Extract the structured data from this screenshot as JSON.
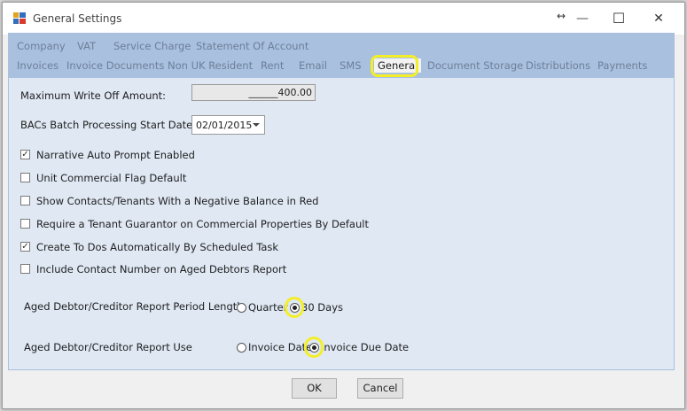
{
  "window": {
    "title": "General Settings",
    "icons": {
      "app": "app-icon",
      "resize": "resize-arrows-icon",
      "minimize": "minimize-icon",
      "maximize": "maximize-icon",
      "close": "close-icon"
    },
    "glyphs": {
      "resize": "↔",
      "minimize": "—",
      "maximize": "☐",
      "close": "✕"
    }
  },
  "tabs": {
    "row1": [
      "Company",
      "VAT",
      "Service Charge",
      "Statement Of Account"
    ],
    "row2": [
      "Invoices",
      "Invoice Documents",
      "Non UK Resident",
      "Rent",
      "Email",
      "SMS",
      "General",
      "Document Storage",
      "Distributions",
      "Payments"
    ],
    "active": "General"
  },
  "form": {
    "max_write_off_label": "Maximum Write Off Amount:",
    "max_write_off_value": "______400.00",
    "bacs_label": "BACs Batch Processing Start Date:",
    "bacs_value": "02/01/2015",
    "checkboxes": [
      {
        "label": "Narrative Auto Prompt Enabled",
        "checked": true
      },
      {
        "label": "Unit Commercial Flag Default",
        "checked": false
      },
      {
        "label": "Show Contacts/Tenants With a Negative Balance in Red",
        "checked": false
      },
      {
        "label": "Require a Tenant Guarantor on Commercial Properties By Default",
        "checked": false
      },
      {
        "label": "Create To Dos Automatically By Scheduled Task",
        "checked": true
      },
      {
        "label": "Include Contact Number on Aged Debtors Report",
        "checked": false
      }
    ],
    "period_label": "Aged Debtor/Creditor Report Period Length",
    "period_options": [
      {
        "label": "Quarter",
        "selected": false
      },
      {
        "label": "30 Days",
        "selected": true
      }
    ],
    "use_label": "Aged Debtor/Creditor Report Use",
    "use_options": [
      {
        "label": "Invoice Date",
        "selected": false
      },
      {
        "label": "Invoice Due Date",
        "selected": true
      }
    ]
  },
  "buttons": {
    "ok": "OK",
    "cancel": "Cancel"
  },
  "colors": {
    "tab_strip": "#a9c0df",
    "panel": "#dfe8f3",
    "highlight": "#f4ee2a"
  }
}
